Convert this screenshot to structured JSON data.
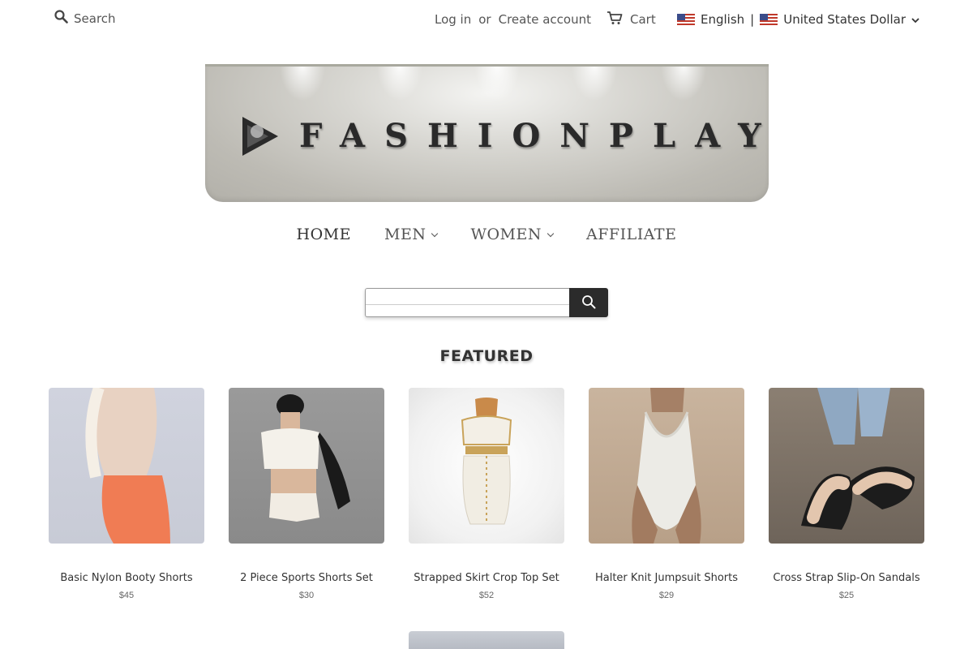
{
  "topbar": {
    "search_label": "Search",
    "login_label": "Log in",
    "or_label": "or",
    "create_account_label": "Create account",
    "cart_label": "Cart",
    "language_label": "English",
    "separator": "|",
    "currency_label": "United States Dollar"
  },
  "banner": {
    "brand": "FASHIONPLAY"
  },
  "nav": {
    "items": [
      {
        "label": "HOME"
      },
      {
        "label": "MEN"
      },
      {
        "label": "WOMEN"
      },
      {
        "label": "AFFILIATE"
      }
    ]
  },
  "center_search": {
    "value": "",
    "placeholder": ""
  },
  "featured": {
    "title": "FEATURED",
    "products": [
      {
        "title": "Basic Nylon Booty Shorts",
        "price": "$45"
      },
      {
        "title": "2 Piece Sports Shorts Set",
        "price": "$30"
      },
      {
        "title": "Strapped Skirt Crop Top Set",
        "price": "$52"
      },
      {
        "title": "Halter Knit Jumpsuit Shorts",
        "price": "$29"
      },
      {
        "title": "Cross Strap Slip-On Sandals",
        "price": "$25"
      }
    ]
  },
  "icons": {
    "search": "search-icon",
    "cart": "cart-icon",
    "flag": "us-flag-icon",
    "chevron": "chevron-down-icon"
  },
  "colors": {
    "search_button_bg": "#2b2b2b",
    "text": "#333333"
  }
}
